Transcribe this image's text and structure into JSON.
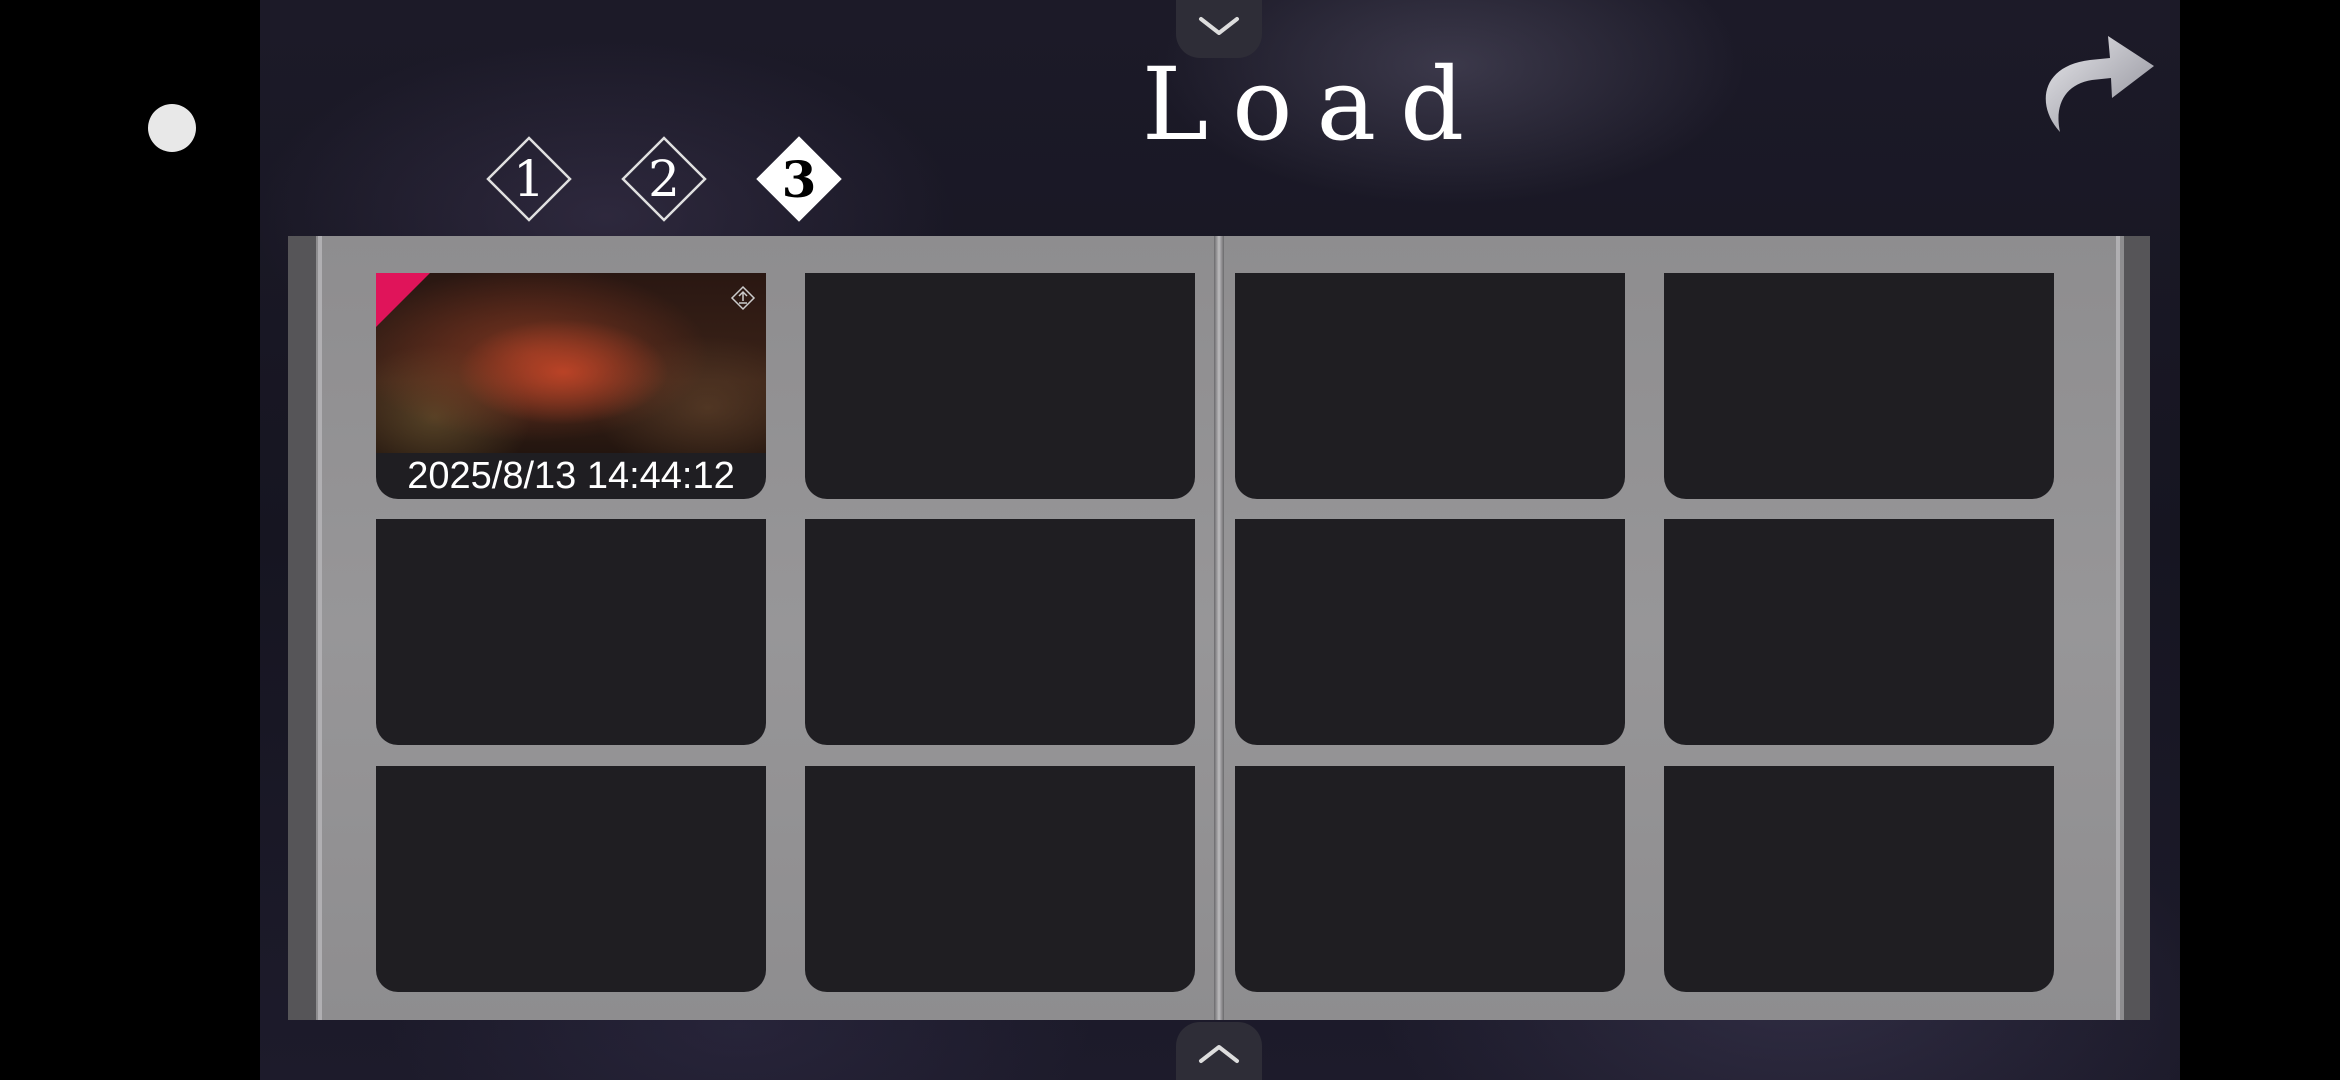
{
  "screen": {
    "title": "Load",
    "tabs": [
      {
        "label": "1",
        "active": false
      },
      {
        "label": "2",
        "active": false
      },
      {
        "label": "3",
        "active": true
      }
    ],
    "navigation": {
      "up_icon": "chevron-down-icon",
      "down_icon": "chevron-up-icon",
      "back_icon": "curved-arrow-icon"
    },
    "save_slots": [
      {
        "filled": true,
        "date": "2025/8/13 14:44:12"
      },
      {
        "filled": false,
        "date": ""
      },
      {
        "filled": false,
        "date": ""
      },
      {
        "filled": false,
        "date": ""
      },
      {
        "filled": false,
        "date": ""
      },
      {
        "filled": false,
        "date": ""
      },
      {
        "filled": false,
        "date": ""
      },
      {
        "filled": false,
        "date": ""
      },
      {
        "filled": false,
        "date": ""
      },
      {
        "filled": false,
        "date": ""
      },
      {
        "filled": false,
        "date": ""
      },
      {
        "filled": false,
        "date": ""
      }
    ]
  },
  "colors": {
    "accent": "#e0145a",
    "slot_bg": "#1f1e22",
    "book_page": "#979698"
  }
}
